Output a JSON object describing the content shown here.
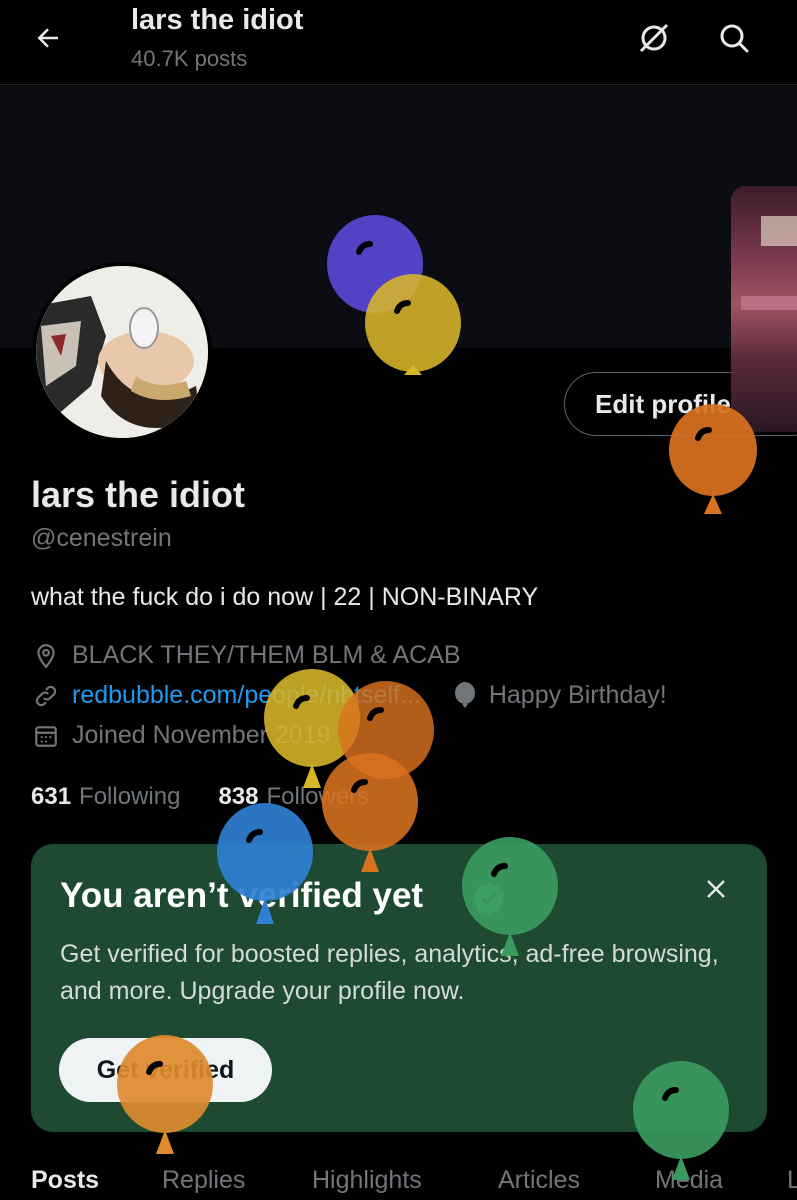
{
  "header": {
    "title": "lars the idiot",
    "post_count": "40.7K posts",
    "back_icon": "back-arrow-icon",
    "hide_icon": "no-symbol-icon",
    "search_icon": "search-icon"
  },
  "profile": {
    "edit_button": "Edit profile",
    "name": "lars the idiot",
    "handle": "@cenestrein",
    "bio": "what the fuck do i do now | 22 | NON-BINARY",
    "location": "BLACK THEY/THEM BLM & ACAB",
    "website": "redbubble.com/people/nbtself...",
    "birthday": "Happy Birthday!",
    "joined": "Joined November 2019",
    "following_count": "631",
    "following_label": "Following",
    "followers_count": "838",
    "followers_label": "Followers"
  },
  "verify_card": {
    "title": "You aren’t verified yet",
    "text": "Get verified for boosted replies, analytics, ad-free browsing, and more. Upgrade your profile now.",
    "button": "Get verified"
  },
  "tabs": [
    "Posts",
    "Replies",
    "Highlights",
    "Articles",
    "Media",
    "L"
  ],
  "active_tab": "Posts",
  "colors": {
    "background": "#000000",
    "accent_link": "#1d9bf0",
    "verify_card_bg": "#1e4a32",
    "balloon_purple": "#5b46d6",
    "balloon_yellow": "#d8b62a",
    "balloon_orange": "#d9721f",
    "balloon_blue": "#2f7fd4",
    "balloon_green": "#3a9a5e"
  }
}
